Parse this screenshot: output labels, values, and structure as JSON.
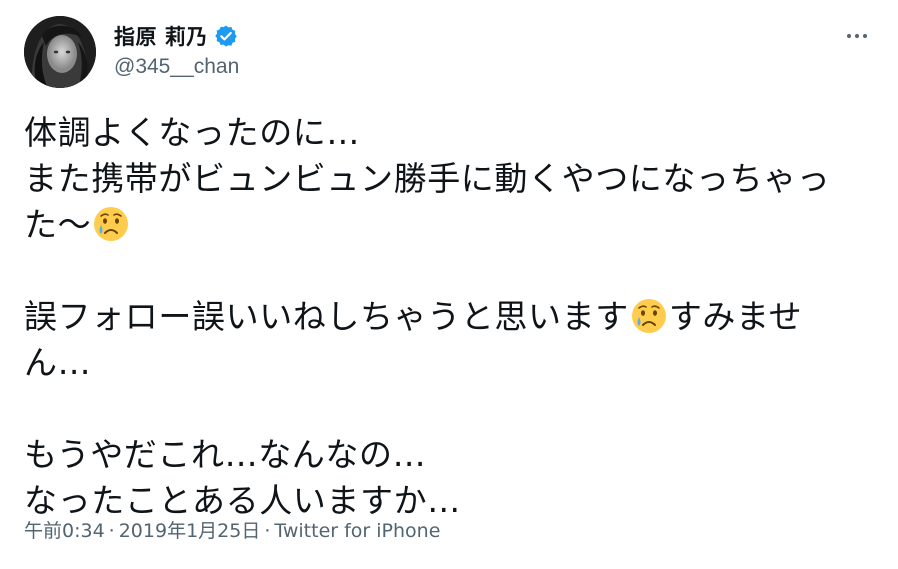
{
  "tweet": {
    "author": {
      "display_name": "指原 莉乃",
      "handle": "@345__chan",
      "verified": true,
      "avatar_icon": "avatar-photo"
    },
    "more_icon": "more-horizontal-icon",
    "body": {
      "line1": "体調よくなったのに…",
      "line2": "また携帯がビュンビュン勝手に動くやつになっちゃっ",
      "line3": "た〜",
      "line4_a": "誤フォロー誤いいねしちゃうと思います",
      "line4_b": "すみませ",
      "line5": "ん…",
      "line6": "もうやだこれ…なんなの…",
      "line7": "なったことある人いますか…",
      "emoji_name": "crying-face-emoji"
    },
    "meta": {
      "time": "午前0:34",
      "separator": "·",
      "date": "2019年1月25日",
      "source": "Twitter for iPhone"
    },
    "colors": {
      "text": "#0f1419",
      "secondary": "#536471",
      "verified": "#1d9bf0"
    }
  }
}
